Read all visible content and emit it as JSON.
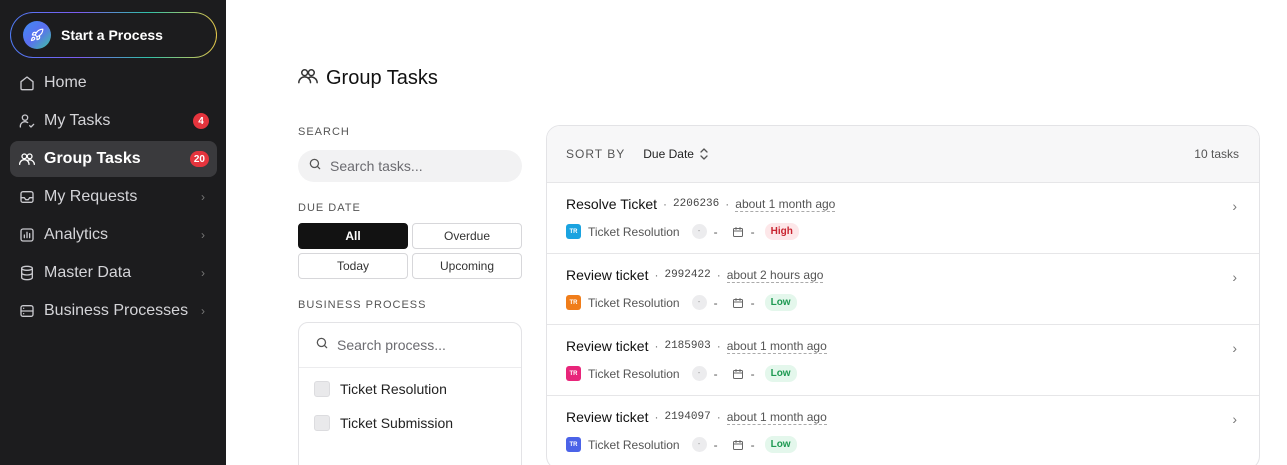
{
  "sidebar": {
    "start_label": "Start a Process",
    "items": [
      {
        "label": "Home",
        "icon": "home-icon"
      },
      {
        "label": "My Tasks",
        "icon": "user-check-icon",
        "badge": "4"
      },
      {
        "label": "Group Tasks",
        "icon": "users-icon",
        "badge": "20",
        "active": true
      },
      {
        "label": "My Requests",
        "icon": "inbox-icon",
        "chevron": true
      },
      {
        "label": "Analytics",
        "icon": "chart-icon",
        "chevron": true
      },
      {
        "label": "Master Data",
        "icon": "database-icon",
        "chevron": true
      },
      {
        "label": "Business Processes",
        "icon": "server-icon",
        "chevron": true
      }
    ]
  },
  "header": {
    "title": "Group Tasks"
  },
  "filters": {
    "search_label": "SEARCH",
    "search_placeholder": "Search tasks...",
    "due_date_label": "DUE DATE",
    "due_date_options": [
      "All",
      "Overdue",
      "Today",
      "Upcoming"
    ],
    "business_process_label": "BUSINESS PROCESS",
    "process_search_placeholder": "Search process...",
    "process_options": [
      "Ticket Resolution",
      "Ticket Submission"
    ]
  },
  "tasks": {
    "sort_label": "SORT BY",
    "sort_value": "Due Date",
    "count": "10 tasks",
    "items": [
      {
        "title": "Resolve Ticket",
        "id": "2206236",
        "time": "about 1 month ago",
        "process_abbr": "TR",
        "process_color": "#1aa3e0",
        "process": "Ticket Resolution",
        "assignee": "-",
        "due": "-",
        "priority": "High"
      },
      {
        "title": "Review ticket",
        "id": "2992422",
        "time": "about 2 hours ago",
        "process_abbr": "TR",
        "process_color": "#f07d1a",
        "process": "Ticket Resolution",
        "assignee": "-",
        "due": "-",
        "priority": "Low"
      },
      {
        "title": "Review ticket",
        "id": "2185903",
        "time": "about 1 month ago",
        "process_abbr": "TR",
        "process_color": "#e8257a",
        "process": "Ticket Resolution",
        "assignee": "-",
        "due": "-",
        "priority": "Low"
      },
      {
        "title": "Review ticket",
        "id": "2194097",
        "time": "about 1 month ago",
        "process_abbr": "TR",
        "process_color": "#4b63e8",
        "process": "Ticket Resolution",
        "assignee": "-",
        "due": "-",
        "priority": "Low"
      }
    ]
  }
}
